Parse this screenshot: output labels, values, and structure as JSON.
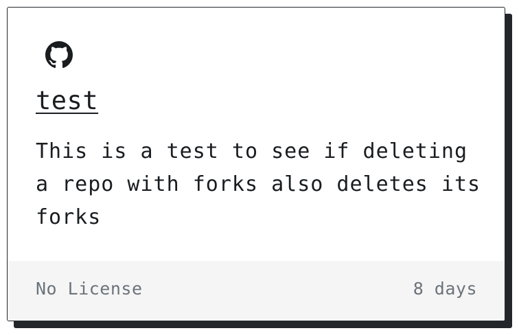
{
  "card": {
    "icon": "github-icon",
    "title": "test",
    "description": "This is a test to see if deleting a repo with forks also deletes its forks",
    "footer": {
      "license": "No License",
      "age": "8 days"
    }
  },
  "colors": {
    "border": "#23272b",
    "shadow": "#23272b",
    "footer_bg": "#f5f5f5",
    "text": "#1a1d20",
    "muted_text": "#6b737b"
  }
}
